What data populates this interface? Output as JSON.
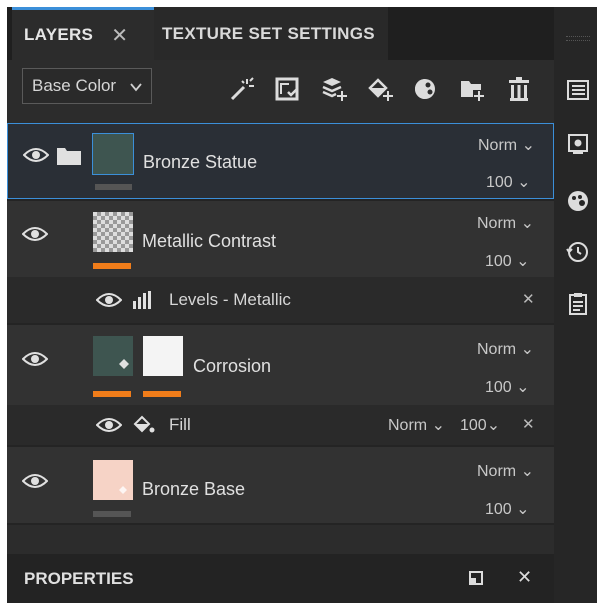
{
  "tabs": {
    "layers": "LAYERS",
    "layers_close": "✕",
    "texture_set": "TEXTURE SET SETTINGS"
  },
  "toolbar": {
    "channel": "Base Color",
    "icons": [
      "magic-wand-icon",
      "add-mask-icon",
      "add-fill-layer-icon",
      "add-paint-layer-icon",
      "add-effect-icon",
      "add-folder-icon",
      "delete-icon"
    ]
  },
  "layers": [
    {
      "name": "Bronze Statue",
      "blend": "Norm",
      "opacity": "100",
      "type": "folder"
    },
    {
      "name": "Metallic Contrast",
      "blend": "Norm",
      "opacity": "100",
      "type": "layer",
      "effect": {
        "name": "Levels - Metallic",
        "close": "✕"
      }
    },
    {
      "name": "Corrosion",
      "blend": "Norm",
      "opacity": "100",
      "type": "layer",
      "effect": {
        "name": "Fill",
        "blend": "Norm",
        "opacity": "100",
        "close": "✕"
      }
    },
    {
      "name": "Bronze Base",
      "blend": "Norm",
      "opacity": "100",
      "type": "layer"
    }
  ],
  "chevron": "⌄",
  "properties": {
    "title": "PROPERTIES",
    "close": "✕"
  },
  "sidebar_icons": [
    "layers-list-icon",
    "camera-icon",
    "palette-icon",
    "history-icon",
    "clipboard-icon"
  ],
  "colors": {
    "accent": "#3b8fd9",
    "orange": "#f07d1a",
    "panel": "#2c2c2c"
  }
}
